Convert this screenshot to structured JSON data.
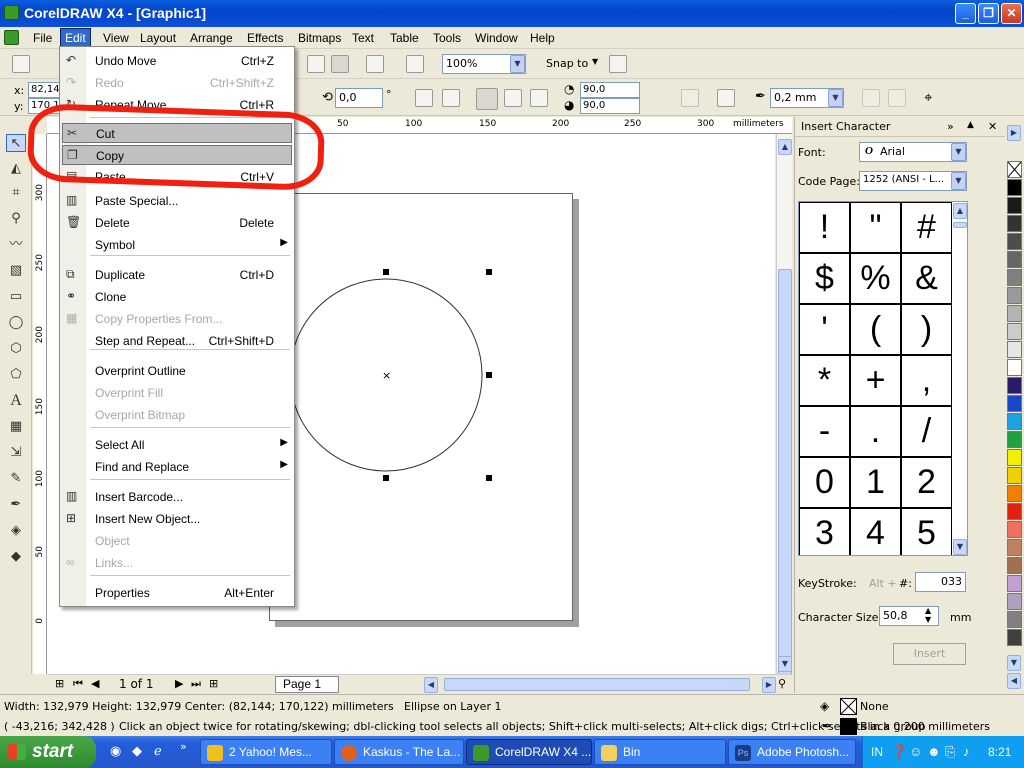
{
  "window": {
    "title": "CorelDRAW X4 - [Graphic1]"
  },
  "menubar": {
    "items": [
      "File",
      "Edit",
      "View",
      "Layout",
      "Arrange",
      "Effects",
      "Bitmaps",
      "Text",
      "Table",
      "Tools",
      "Window",
      "Help"
    ],
    "active": "Edit"
  },
  "toolbar": {
    "zoom": "100%",
    "snap_to": "Snap to"
  },
  "propbar": {
    "x_label": "x:",
    "y_label": "y:",
    "x_value": "82,14",
    "y_value": "170,1",
    "rotation": "0,0",
    "degree": "°",
    "angle1": "90,0",
    "angle2": "90,0",
    "outline_width": "0,2 mm"
  },
  "rulers": {
    "unit": "millimeters",
    "h_ticks": [
      "50",
      "100",
      "150",
      "200",
      "250",
      "300"
    ],
    "v_ticks": [
      "300",
      "250",
      "200",
      "150",
      "100",
      "50",
      "0"
    ]
  },
  "edit_menu": [
    {
      "label": "Undo Move",
      "shortcut": "Ctrl+Z",
      "disabled": false,
      "icon": "undo-icon"
    },
    {
      "label": "Redo",
      "shortcut": "Ctrl+Shift+Z",
      "disabled": true,
      "icon": "redo-icon"
    },
    {
      "label": "Repeat Move",
      "shortcut": "Ctrl+R",
      "disabled": false,
      "icon": "repeat-icon"
    },
    {
      "label": "Cut",
      "shortcut": "",
      "disabled": false,
      "icon": "scissors-icon"
    },
    {
      "label": "Copy",
      "shortcut": "",
      "disabled": false,
      "icon": "copy-icon"
    },
    {
      "label": "Paste",
      "shortcut": "Ctrl+V",
      "disabled": false,
      "icon": "paste-icon"
    },
    {
      "label": "Paste Special...",
      "shortcut": "",
      "disabled": false,
      "icon": "paste-special-icon"
    },
    {
      "label": "Delete",
      "shortcut": "Delete",
      "disabled": false,
      "icon": "trash-icon"
    },
    {
      "label": "Symbol",
      "shortcut": "",
      "disabled": false,
      "submenu": true
    },
    {
      "label": "Duplicate",
      "shortcut": "Ctrl+D",
      "disabled": false,
      "icon": "duplicate-icon"
    },
    {
      "label": "Clone",
      "shortcut": "",
      "disabled": false,
      "icon": "clone-icon"
    },
    {
      "label": "Copy Properties From...",
      "shortcut": "",
      "disabled": true,
      "icon": "copy-properties-icon"
    },
    {
      "label": "Step and Repeat...",
      "shortcut": "Ctrl+Shift+D",
      "disabled": false
    },
    {
      "label": "Overprint Outline",
      "shortcut": "",
      "disabled": false
    },
    {
      "label": "Overprint Fill",
      "shortcut": "",
      "disabled": true
    },
    {
      "label": "Overprint Bitmap",
      "shortcut": "",
      "disabled": true
    },
    {
      "label": "Select All",
      "shortcut": "",
      "disabled": false,
      "submenu": true
    },
    {
      "label": "Find and Replace",
      "shortcut": "",
      "disabled": false,
      "submenu": true
    },
    {
      "label": "Insert Barcode...",
      "shortcut": "",
      "disabled": false,
      "icon": "barcode-icon"
    },
    {
      "label": "Insert New Object...",
      "shortcut": "",
      "disabled": false,
      "icon": "insert-object-icon"
    },
    {
      "label": "Object",
      "shortcut": "",
      "disabled": true
    },
    {
      "label": "Links...",
      "shortcut": "",
      "disabled": true,
      "icon": "ole-icon"
    },
    {
      "label": "Properties",
      "shortcut": "Alt+Enter",
      "disabled": false
    }
  ],
  "docker": {
    "title": "Insert Character",
    "font_label": "Font:",
    "font_value": "Arial",
    "codepage_label": "Code Page:",
    "codepage_value": "1252  (ANSI - L...",
    "chars": [
      "!",
      "\"",
      "#",
      "$",
      "%",
      "&",
      "'",
      "(",
      ")",
      "*",
      "+",
      ",",
      "-",
      ".",
      "/",
      "0",
      "1",
      "2",
      "3",
      "4",
      "5"
    ],
    "keystroke_label": "KeyStroke:",
    "keystroke_alt": "Alt +",
    "keystroke_hash": "#:",
    "keystroke_value": "033",
    "charsize_label": "Character Size:",
    "charsize_value": "50,8",
    "charsize_unit": "mm",
    "insert_label": "Insert"
  },
  "palette": [
    "#ffffff",
    "#000000",
    "#1a1a1a",
    "#333333",
    "#4d4d4d",
    "#666666",
    "#808080",
    "#999999",
    "#b3b3b3",
    "#cccccc",
    "#e6e6e6",
    "#ffffff",
    "#2a1a6a",
    "#1848c8",
    "#20a0e0",
    "#20a040",
    "#f0f000",
    "#f0d000",
    "#f08000",
    "#e02010",
    "#f07060",
    "#c08060",
    "#a07050",
    "#c0a0d0",
    "#b0a0c0",
    "#808080",
    "#404040"
  ],
  "pages": {
    "counter": "1 of 1",
    "tab": "Page 1"
  },
  "status": {
    "line1": "Width: 132,979  Height: 132,979  Center: (82,144; 170,122)  millimeters",
    "object": "Ellipse on Layer 1",
    "fill": "None",
    "line2": "( -43,216; 342,428 )",
    "hint": "Click an object twice for rotating/skewing; dbl-clicking tool selects all objects; Shift+click multi-selects; Alt+click digs; Ctrl+click selects in a group",
    "outline": "Black  0,200 millimeters"
  },
  "taskbar": {
    "start": "start",
    "tasks": [
      "2 Yahoo! Mes...",
      "Kaskus - The La...",
      "CorelDRAW X4 ...",
      "Bin",
      "Adobe Photosh..."
    ],
    "lang": "IN",
    "time": "8:21"
  }
}
